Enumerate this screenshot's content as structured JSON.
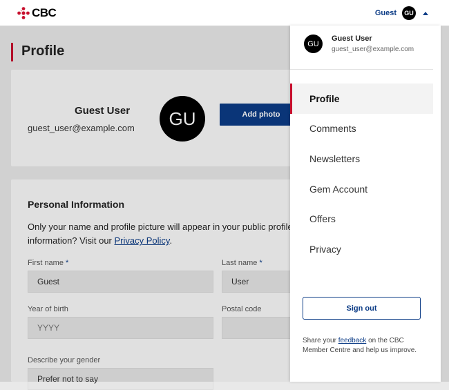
{
  "header": {
    "logo_text": "CBC",
    "user_name": "Guest",
    "avatar_initials": "GU"
  },
  "page": {
    "title": "Profile"
  },
  "profile_card": {
    "name": "Guest User",
    "email": "guest_user@example.com",
    "avatar_initials": "GU",
    "add_photo_label": "Add photo"
  },
  "personal_info": {
    "title": "Personal Information",
    "text_line1": "Only your name and profile picture will appear in your public profile",
    "text_line2_prefix": "information? Visit our ",
    "privacy_link": "Privacy Policy",
    "text_line2_suffix": ".",
    "required_marker": "*",
    "first_name_label": "First name",
    "first_name_value": "Guest",
    "last_name_label": "Last name",
    "last_name_value": "User",
    "year_label": "Year of birth",
    "year_placeholder": "YYYY",
    "postal_label": "Postal code",
    "postal_value": "",
    "gender_label": "Describe your gender",
    "gender_value": "Prefer not to say"
  },
  "menu": {
    "user_name": "Guest User",
    "user_email": "guest_user@example.com",
    "avatar_initials": "GU",
    "items": [
      {
        "label": "Profile",
        "active": true
      },
      {
        "label": "Comments"
      },
      {
        "label": "Newsletters"
      },
      {
        "label": "Gem Account"
      },
      {
        "label": "Offers"
      },
      {
        "label": "Privacy"
      }
    ],
    "sign_out_label": "Sign out",
    "feedback_prefix": "Share your ",
    "feedback_link": "feedback",
    "feedback_suffix": " on the CBC Member Centre and help us improve."
  },
  "colors": {
    "brand_red": "#c8102e",
    "link_blue": "#0c3c86"
  }
}
